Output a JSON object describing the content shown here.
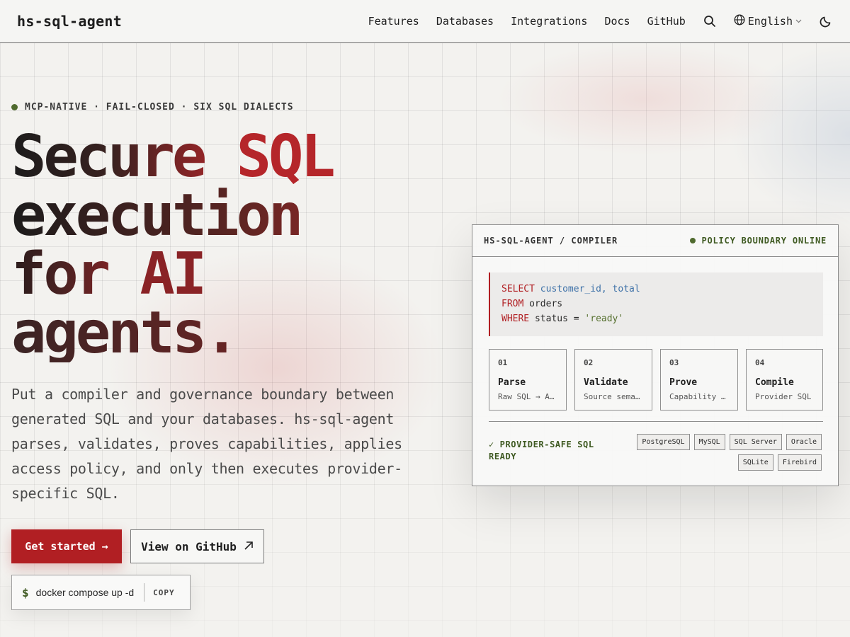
{
  "header": {
    "brand": "hs-sql-agent",
    "nav": [
      "Features",
      "Databases",
      "Integrations",
      "Docs",
      "GitHub"
    ],
    "search_icon": "search-icon",
    "language": "English",
    "theme_icon": "moon-icon"
  },
  "hero": {
    "tagline": "MCP-NATIVE · FAIL-CLOSED · SIX SQL DIALECTS",
    "headline": {
      "l1a": "Secure ",
      "l1b": "SQL",
      "l2": "execution",
      "l3a": "for ",
      "l3b": "AI",
      "l4": "agents."
    },
    "lede": "Put a compiler and governance boundary between generated SQL and your databases. hs-sql-agent parses, validates, proves capabilities, applies access policy, and only then executes provider-specific SQL.",
    "primary_button": "Get started →",
    "secondary_button": "View on GitHub",
    "secondary_button_icon": "arrow-up-right-icon",
    "command_prompt": "$",
    "command": "docker compose up -d",
    "copy_label": "COPY"
  },
  "panel": {
    "title": "HS-SQL-AGENT / COMPILER",
    "status": "POLICY BOUNDARY ONLINE",
    "code": {
      "l1kw": "SELECT",
      "l1id": "customer_id, total",
      "l2kw": "FROM",
      "l2rest": "orders",
      "l3kw": "WHERE",
      "l3rest": "status = ",
      "l3str": "'ready'"
    },
    "steps": [
      {
        "num": "01",
        "name": "Parse",
        "desc": "Raw SQL → AST"
      },
      {
        "num": "02",
        "name": "Validate",
        "desc": "Source semantics"
      },
      {
        "num": "03",
        "name": "Prove",
        "desc": "Capability boundary"
      },
      {
        "num": "04",
        "name": "Compile",
        "desc": "Provider SQL"
      }
    ],
    "ready": "✓ PROVIDER-SAFE SQL READY",
    "dialects": [
      "PostgreSQL",
      "MySQL",
      "SQL Server",
      "Oracle",
      "SQLite",
      "Firebird"
    ]
  },
  "colors": {
    "accent": "#b11f23",
    "status_green": "#3f5a22",
    "background": "#f3f2ef"
  }
}
